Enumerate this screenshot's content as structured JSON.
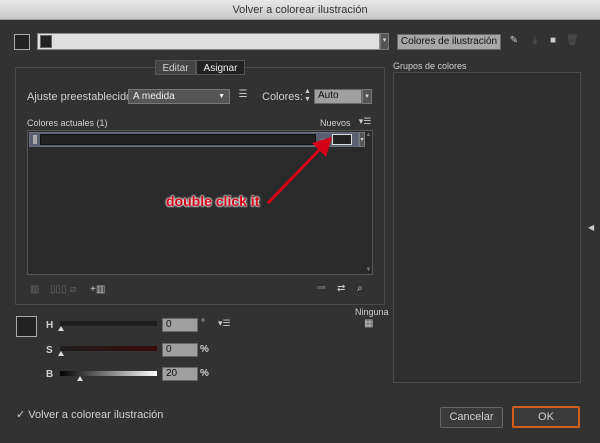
{
  "window": {
    "title": "Volver a colorear ilustración"
  },
  "top": {
    "artwork_colors_button": "Colores de ilustración"
  },
  "tabs": [
    {
      "label": "Editar"
    },
    {
      "label": "Asignar"
    }
  ],
  "preset": {
    "label": "Ajuste preestablecido:",
    "value": "A medida"
  },
  "colors": {
    "label": "Colores:",
    "value": "Auto"
  },
  "list": {
    "current_label": "Colores actuales (1)",
    "new_label": "Nuevos"
  },
  "annotation": "double click it",
  "hsb": {
    "h_label": "H",
    "h_value": "0",
    "h_unit": "°",
    "s_label": "S",
    "s_value": "0",
    "s_unit": "%",
    "b_label": "B",
    "b_value": "20",
    "b_unit": "%",
    "h_fraction": 0,
    "s_fraction": 0,
    "b_fraction": 0.2
  },
  "ninguna": "Ninguna",
  "groups": {
    "label": "Grupos de colores"
  },
  "footer": {
    "recolor_label": "Volver a colorear ilustración",
    "recolor_checked": true,
    "cancel": "Cancelar",
    "ok": "OK"
  },
  "accent": "#d2601a"
}
